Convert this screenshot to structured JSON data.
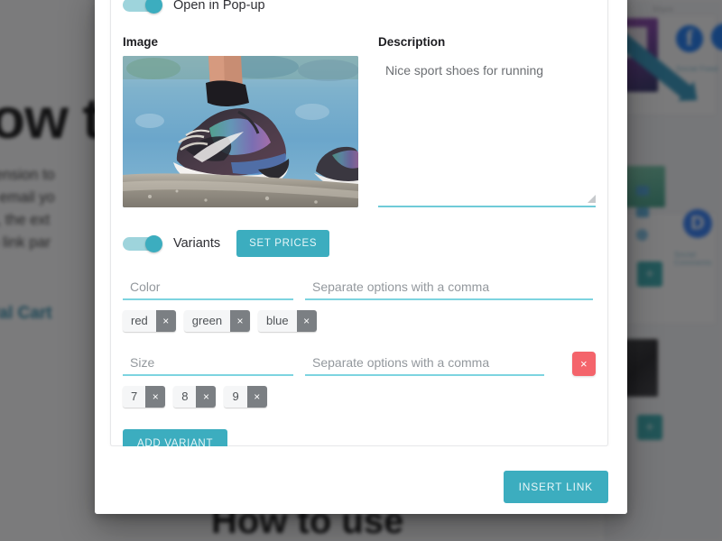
{
  "background": {
    "heading_top": "How to",
    "paragraph_lines": [
      "e extension to",
      "n the email yo",
      "alling, the ext",
      "tch to link par"
    ],
    "link_text": "PayPal Cart",
    "heading_bottom": "How to use",
    "right_panel": {
      "top_label": "Share",
      "social_label": "Social Feed",
      "comments_label": "Social Comments",
      "plus_label": "+",
      "facebook_glyph": "f",
      "disqus_glyph": "D"
    }
  },
  "dialog": {
    "popup_toggle": {
      "label": "Open in Pop-up",
      "state": "on"
    },
    "image": {
      "heading": "Image",
      "alt": "sport shoes on concrete ledge by the water"
    },
    "description": {
      "heading": "Description",
      "value": "Nice sport shoes for running"
    },
    "variants": {
      "toggle_label": "Variants",
      "toggle_state": "on",
      "set_prices_label": "SET PRICES",
      "add_variant_label": "ADD VARIANT",
      "remove_label": "×",
      "options_placeholder": "Separate options with a comma",
      "rows": [
        {
          "name": "Color",
          "name_placeholder": "Color",
          "options_value": "",
          "chips": [
            "red",
            "green",
            "blue"
          ],
          "removable": false
        },
        {
          "name": "Size",
          "name_placeholder": "Size",
          "options_value": "",
          "chips": [
            "7",
            "8",
            "9"
          ],
          "removable": true
        }
      ],
      "chip_remove_glyph": "×"
    },
    "footer": {
      "insert_link_label": "INSERT LINK"
    }
  },
  "colors": {
    "teal": "#3cadbf",
    "teal_underline": "#7dd4e0",
    "red": "#f4646b",
    "chip_remove": "#7b7f83",
    "link_blue": "#2b88a8"
  }
}
